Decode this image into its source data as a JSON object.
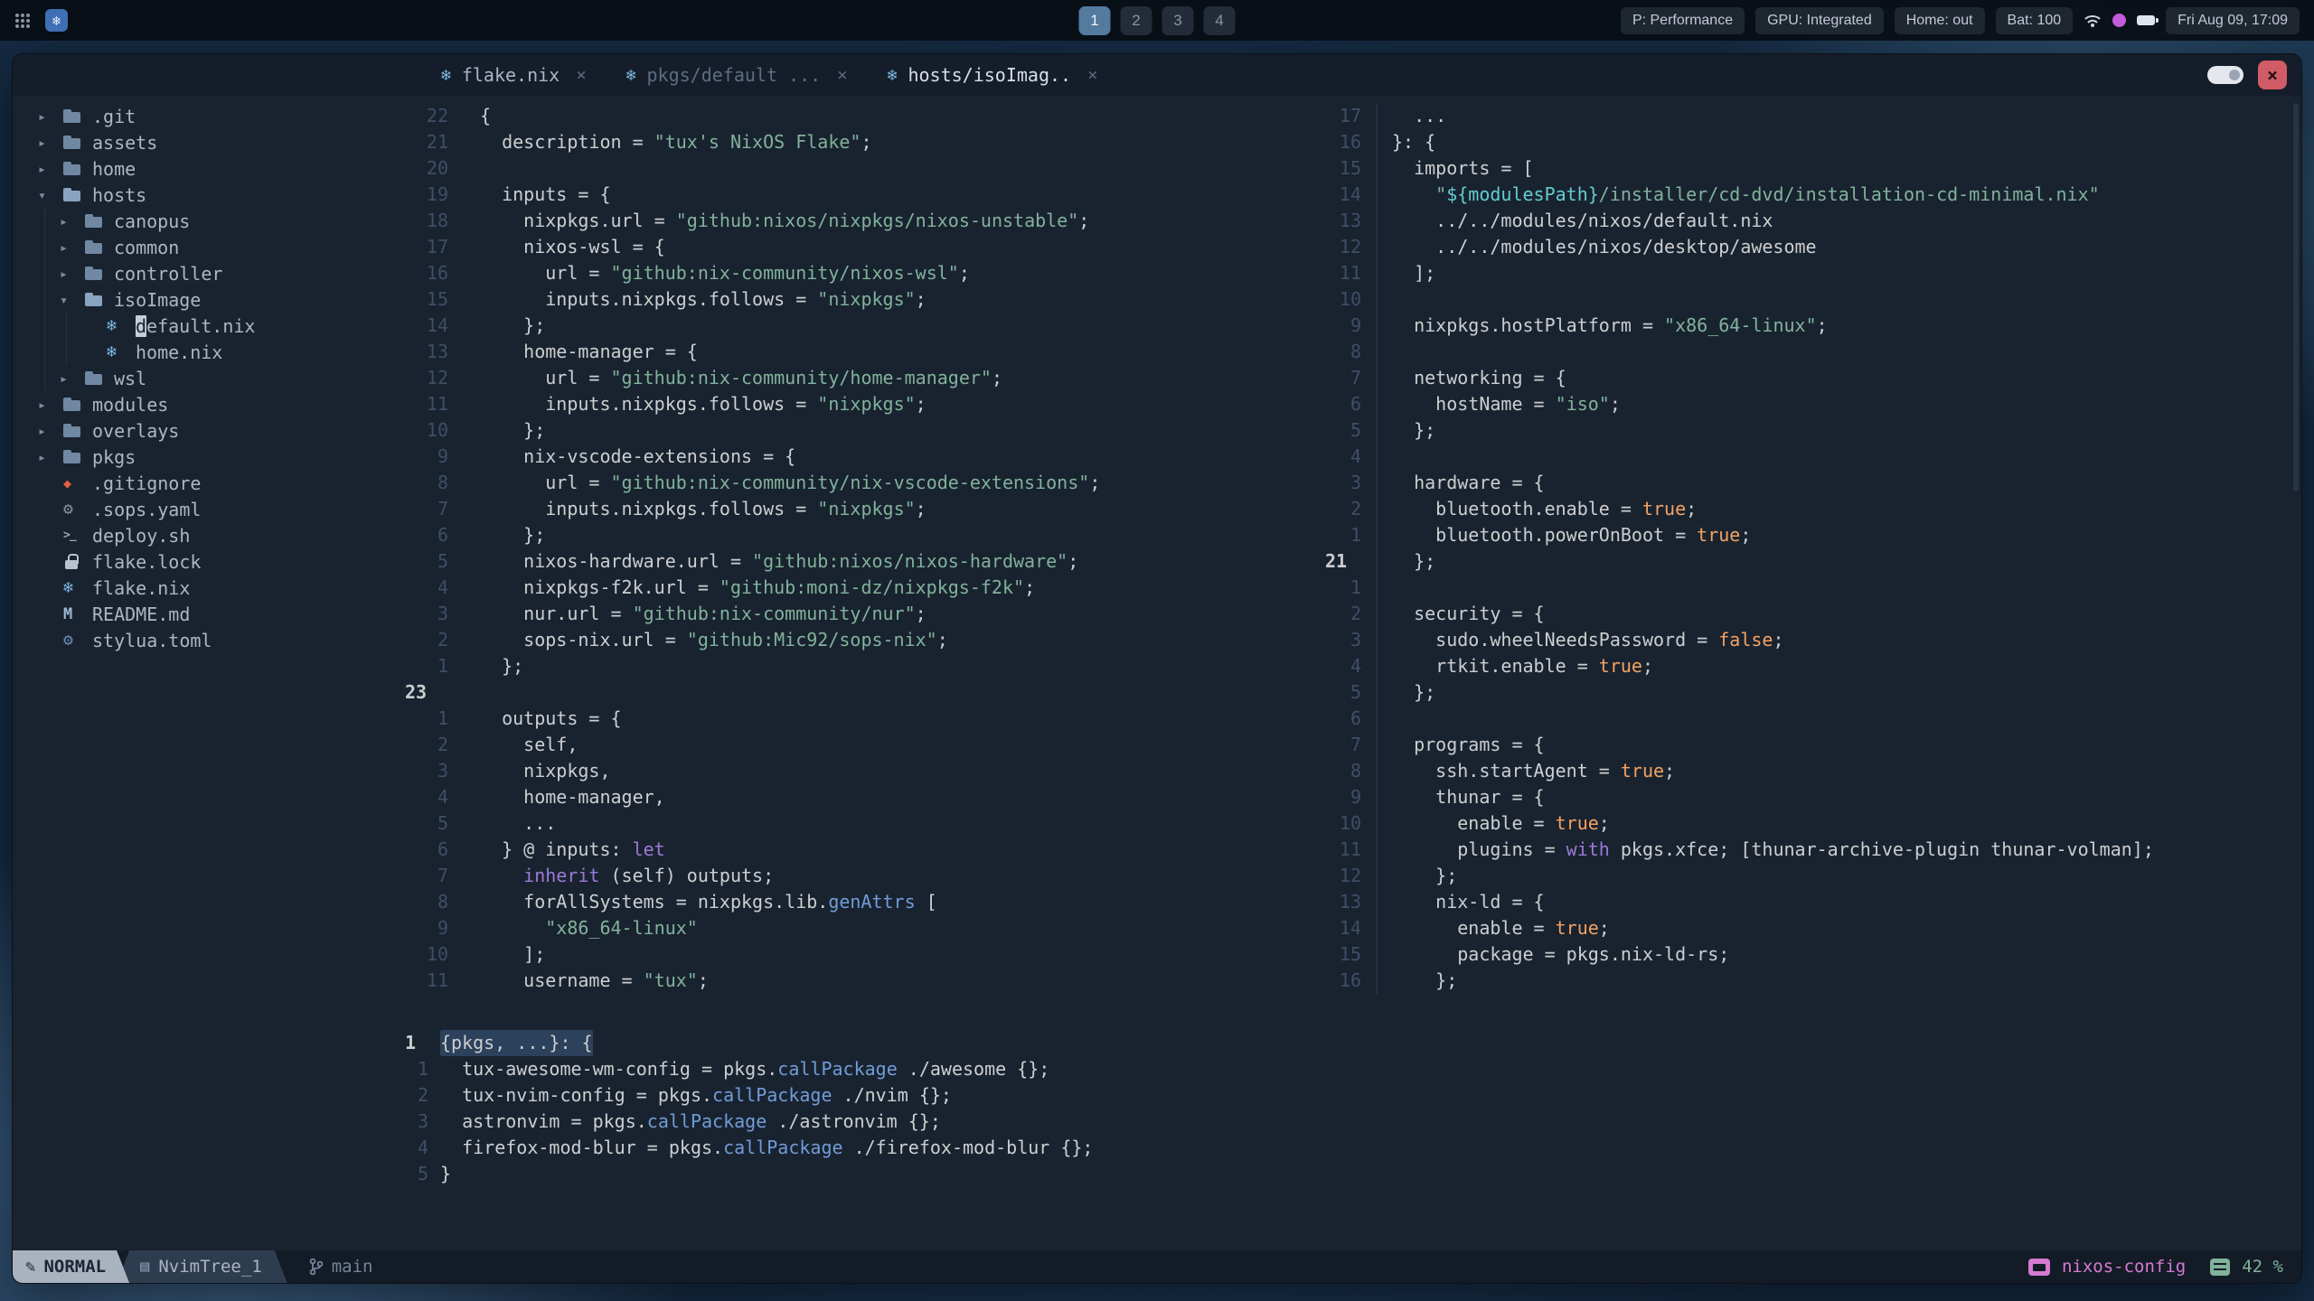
{
  "colors": {
    "editor_bg": "#192330",
    "panel_bg": "#141d29",
    "accent_blue": "#719cd6",
    "nix_blue": "#7ebae4",
    "string_green": "#81b29a",
    "orange": "#f4a261",
    "magenta": "#9d79d6",
    "cyan": "#63cdcf",
    "pink": "#d67ad2",
    "close_red": "#d15b66",
    "foreground": "#cdcecf",
    "workspace_active": "#547a9e"
  },
  "icon_glyphs": {
    "nix": "❄",
    "git": "◆",
    "gear": "⚙",
    "toml": "⚙",
    "shell": ">_",
    "markdown": "M",
    "folder": "",
    "folder-open": "",
    "lock": "",
    "pencil": "✎",
    "buffer": "▤"
  },
  "topbar": {
    "workspaces": [
      "1",
      "2",
      "3",
      "4"
    ],
    "active_workspace": "1",
    "pills": [
      "P: Performance",
      "GPU: Integrated",
      "Home: out",
      "Bat: 100"
    ],
    "clock": "Fri Aug 09, 17:09"
  },
  "window_controls": {
    "close": "×"
  },
  "tabline": {
    "tabs": [
      {
        "icon": "nix",
        "label": "flake.nix",
        "close": "×",
        "state": "inactive-visible"
      },
      {
        "icon": "nix",
        "label": "pkgs/default ...",
        "close": "×",
        "state": "inactive"
      },
      {
        "icon": "nix",
        "label": "hosts/isoImag..",
        "close": "×",
        "state": "active"
      }
    ]
  },
  "tree": {
    "items": [
      {
        "depth": 0,
        "arrow": "▸",
        "icon": "folder",
        "label": ".git"
      },
      {
        "depth": 0,
        "arrow": "▸",
        "icon": "folder",
        "label": "assets"
      },
      {
        "depth": 0,
        "arrow": "▸",
        "icon": "folder",
        "label": "home"
      },
      {
        "depth": 0,
        "arrow": "▾",
        "icon": "folder-open",
        "label": "hosts"
      },
      {
        "depth": 1,
        "arrow": "▸",
        "icon": "folder",
        "label": "canopus"
      },
      {
        "depth": 1,
        "arrow": "▸",
        "icon": "folder",
        "label": "common"
      },
      {
        "depth": 1,
        "arrow": "▸",
        "icon": "folder",
        "label": "controller"
      },
      {
        "depth": 1,
        "arrow": "▾",
        "icon": "folder-open",
        "label": "isoImage"
      },
      {
        "depth": 2,
        "arrow": "",
        "icon": "nix",
        "label": "default.nix",
        "cursor": true
      },
      {
        "depth": 2,
        "arrow": "",
        "icon": "nix",
        "label": "home.nix"
      },
      {
        "depth": 1,
        "arrow": "▸",
        "icon": "folder",
        "label": "wsl"
      },
      {
        "depth": 0,
        "arrow": "▸",
        "icon": "folder",
        "label": "modules"
      },
      {
        "depth": 0,
        "arrow": "▸",
        "icon": "folder",
        "label": "overlays"
      },
      {
        "depth": 0,
        "arrow": "▸",
        "icon": "folder",
        "label": "pkgs"
      },
      {
        "depth": 0,
        "arrow": "",
        "icon": "git",
        "label": ".gitignore"
      },
      {
        "depth": 0,
        "arrow": "",
        "icon": "gear",
        "label": ".sops.yaml"
      },
      {
        "depth": 0,
        "arrow": "",
        "icon": "shell",
        "label": "deploy.sh"
      },
      {
        "depth": 0,
        "arrow": "",
        "icon": "lock",
        "label": "flake.lock"
      },
      {
        "depth": 0,
        "arrow": "",
        "icon": "nix",
        "label": "flake.nix"
      },
      {
        "depth": 0,
        "arrow": "",
        "icon": "markdown",
        "label": "README.md"
      },
      {
        "depth": 0,
        "arrow": "",
        "icon": "toml",
        "label": "stylua.toml"
      }
    ]
  },
  "panes": {
    "left": {
      "file": "flake.nix",
      "lines": [
        {
          "n": "22",
          "t": [
            [
              "f",
              "{"
            ]
          ]
        },
        {
          "n": "21",
          "t": [
            [
              "f",
              "  description = "
            ],
            [
              "s",
              "\"tux's NixOS Flake\""
            ],
            [
              "f",
              ";"
            ]
          ]
        },
        {
          "n": "20",
          "t": []
        },
        {
          "n": "19",
          "t": [
            [
              "f",
              "  inputs = {"
            ]
          ]
        },
        {
          "n": "18",
          "t": [
            [
              "f",
              "    nixpkgs.url = "
            ],
            [
              "s",
              "\"github:nixos/nixpkgs/nixos-unstable\""
            ],
            [
              "f",
              ";"
            ]
          ]
        },
        {
          "n": "17",
          "t": [
            [
              "f",
              "    nixos-wsl = {"
            ]
          ]
        },
        {
          "n": "16",
          "t": [
            [
              "f",
              "      url = "
            ],
            [
              "s",
              "\"github:nix-community/nixos-wsl\""
            ],
            [
              "f",
              ";"
            ]
          ]
        },
        {
          "n": "15",
          "t": [
            [
              "f",
              "      inputs.nixpkgs.follows = "
            ],
            [
              "s",
              "\"nixpkgs\""
            ],
            [
              "f",
              ";"
            ]
          ]
        },
        {
          "n": "14",
          "t": [
            [
              "f",
              "    };"
            ]
          ]
        },
        {
          "n": "13",
          "t": [
            [
              "f",
              "    home-manager = {"
            ]
          ]
        },
        {
          "n": "12",
          "t": [
            [
              "f",
              "      url = "
            ],
            [
              "s",
              "\"github:nix-community/home-manager\""
            ],
            [
              "f",
              ";"
            ]
          ]
        },
        {
          "n": "11",
          "t": [
            [
              "f",
              "      inputs.nixpkgs.follows = "
            ],
            [
              "s",
              "\"nixpkgs\""
            ],
            [
              "f",
              ";"
            ]
          ]
        },
        {
          "n": "10",
          "t": [
            [
              "f",
              "    };"
            ]
          ]
        },
        {
          "n": "9",
          "t": [
            [
              "f",
              "    nix-vscode-extensions = {"
            ]
          ]
        },
        {
          "n": "8",
          "t": [
            [
              "f",
              "      url = "
            ],
            [
              "s",
              "\"github:nix-community/nix-vscode-extensions\""
            ],
            [
              "f",
              ";"
            ]
          ]
        },
        {
          "n": "7",
          "t": [
            [
              "f",
              "      inputs.nixpkgs.follows = "
            ],
            [
              "s",
              "\"nixpkgs\""
            ],
            [
              "f",
              ";"
            ]
          ]
        },
        {
          "n": "6",
          "t": [
            [
              "f",
              "    };"
            ]
          ]
        },
        {
          "n": "5",
          "t": [
            [
              "f",
              "    nixos-hardware.url = "
            ],
            [
              "s",
              "\"github:nixos/nixos-hardware\""
            ],
            [
              "f",
              ";"
            ]
          ]
        },
        {
          "n": "4",
          "t": [
            [
              "f",
              "    nixpkgs-f2k.url = "
            ],
            [
              "s",
              "\"github:moni-dz/nixpkgs-f2k\""
            ],
            [
              "f",
              ";"
            ]
          ]
        },
        {
          "n": "3",
          "t": [
            [
              "f",
              "    nur.url = "
            ],
            [
              "s",
              "\"github:nix-community/nur\""
            ],
            [
              "f",
              ";"
            ]
          ]
        },
        {
          "n": "2",
          "t": [
            [
              "f",
              "    sops-nix.url = "
            ],
            [
              "s",
              "\"github:Mic92/sops-nix\""
            ],
            [
              "f",
              ";"
            ]
          ]
        },
        {
          "n": "1",
          "t": [
            [
              "f",
              "  };"
            ]
          ]
        },
        {
          "n": "23",
          "cur": true,
          "t": []
        },
        {
          "n": "1",
          "t": [
            [
              "f",
              "  outputs = {"
            ]
          ]
        },
        {
          "n": "2",
          "t": [
            [
              "f",
              "    self,"
            ]
          ]
        },
        {
          "n": "3",
          "t": [
            [
              "f",
              "    nixpkgs,"
            ]
          ]
        },
        {
          "n": "4",
          "t": [
            [
              "f",
              "    home-manager,"
            ]
          ]
        },
        {
          "n": "5",
          "t": [
            [
              "f",
              "    ..."
            ]
          ]
        },
        {
          "n": "6",
          "t": [
            [
              "f",
              "  } @ inputs: "
            ],
            [
              "k",
              "let"
            ]
          ]
        },
        {
          "n": "7",
          "t": [
            [
              "f",
              "    "
            ],
            [
              "k",
              "inherit"
            ],
            [
              "f",
              " (self) outputs;"
            ]
          ]
        },
        {
          "n": "8",
          "t": [
            [
              "f",
              "    forAllSystems = nixpkgs.lib."
            ],
            [
              "u",
              "genAttrs"
            ],
            [
              "f",
              " ["
            ]
          ]
        },
        {
          "n": "9",
          "t": [
            [
              "f",
              "      "
            ],
            [
              "s",
              "\"x86_64-linux\""
            ]
          ]
        },
        {
          "n": "10",
          "t": [
            [
              "f",
              "    ];"
            ]
          ]
        },
        {
          "n": "11",
          "t": [
            [
              "f",
              "    username = "
            ],
            [
              "s",
              "\"tux\""
            ],
            [
              "f",
              ";"
            ]
          ]
        }
      ]
    },
    "right": {
      "file": "hosts/isoImage/default.nix",
      "lines": [
        {
          "n": "17",
          "t": [
            [
              "f",
              "  ..."
            ]
          ]
        },
        {
          "n": "16",
          "t": [
            [
              "f",
              "}: {"
            ]
          ]
        },
        {
          "n": "15",
          "t": [
            [
              "f",
              "  imports = ["
            ]
          ]
        },
        {
          "n": "14",
          "t": [
            [
              "f",
              "    "
            ],
            [
              "s",
              "\""
            ],
            [
              "c",
              "${modulesPath}"
            ],
            [
              "s",
              "/installer/cd-dvd/installation-cd-minimal.nix\""
            ]
          ]
        },
        {
          "n": "13",
          "t": [
            [
              "f",
              "    ../../modules/nixos/default.nix"
            ]
          ]
        },
        {
          "n": "12",
          "t": [
            [
              "f",
              "    ../../modules/nixos/desktop/awesome"
            ]
          ]
        },
        {
          "n": "11",
          "t": [
            [
              "f",
              "  ];"
            ]
          ]
        },
        {
          "n": "10",
          "t": []
        },
        {
          "n": "9",
          "t": [
            [
              "f",
              "  nixpkgs.hostPlatform = "
            ],
            [
              "s",
              "\"x86_64-linux\""
            ],
            [
              "f",
              ";"
            ]
          ]
        },
        {
          "n": "8",
          "t": []
        },
        {
          "n": "7",
          "t": [
            [
              "f",
              "  networking = {"
            ]
          ]
        },
        {
          "n": "6",
          "t": [
            [
              "f",
              "    hostName = "
            ],
            [
              "s",
              "\"iso\""
            ],
            [
              "f",
              ";"
            ]
          ]
        },
        {
          "n": "5",
          "t": [
            [
              "f",
              "  };"
            ]
          ]
        },
        {
          "n": "4",
          "t": []
        },
        {
          "n": "3",
          "t": [
            [
              "f",
              "  hardware = {"
            ]
          ]
        },
        {
          "n": "2",
          "t": [
            [
              "f",
              "    bluetooth.enable = "
            ],
            [
              "b",
              "true"
            ],
            [
              "f",
              ";"
            ]
          ]
        },
        {
          "n": "1",
          "t": [
            [
              "f",
              "    bluetooth.powerOnBoot = "
            ],
            [
              "b",
              "true"
            ],
            [
              "f",
              ";"
            ]
          ]
        },
        {
          "n": "21",
          "cur": true,
          "t": [
            [
              "f",
              "  };"
            ]
          ]
        },
        {
          "n": "1",
          "t": []
        },
        {
          "n": "2",
          "t": [
            [
              "f",
              "  security = {"
            ]
          ]
        },
        {
          "n": "3",
          "t": [
            [
              "f",
              "    sudo.wheelNeedsPassword = "
            ],
            [
              "b",
              "false"
            ],
            [
              "f",
              ";"
            ]
          ]
        },
        {
          "n": "4",
          "t": [
            [
              "f",
              "    rtkit.enable = "
            ],
            [
              "b",
              "true"
            ],
            [
              "f",
              ";"
            ]
          ]
        },
        {
          "n": "5",
          "t": [
            [
              "f",
              "  };"
            ]
          ]
        },
        {
          "n": "6",
          "t": []
        },
        {
          "n": "7",
          "t": [
            [
              "f",
              "  programs = {"
            ]
          ]
        },
        {
          "n": "8",
          "t": [
            [
              "f",
              "    ssh.startAgent = "
            ],
            [
              "b",
              "true"
            ],
            [
              "f",
              ";"
            ]
          ]
        },
        {
          "n": "9",
          "t": [
            [
              "f",
              "    thunar = {"
            ]
          ]
        },
        {
          "n": "10",
          "t": [
            [
              "f",
              "      enable = "
            ],
            [
              "b",
              "true"
            ],
            [
              "f",
              ";"
            ]
          ]
        },
        {
          "n": "11",
          "t": [
            [
              "f",
              "      plugins = "
            ],
            [
              "k",
              "with"
            ],
            [
              "f",
              " pkgs.xfce; [thunar-archive-plugin thunar-volman];"
            ]
          ]
        },
        {
          "n": "12",
          "t": [
            [
              "f",
              "    };"
            ]
          ]
        },
        {
          "n": "13",
          "t": [
            [
              "f",
              "    nix-ld = {"
            ]
          ]
        },
        {
          "n": "14",
          "t": [
            [
              "f",
              "      enable = "
            ],
            [
              "b",
              "true"
            ],
            [
              "f",
              ";"
            ]
          ]
        },
        {
          "n": "15",
          "t": [
            [
              "f",
              "      package = pkgs.nix-ld-rs;"
            ]
          ]
        },
        {
          "n": "16",
          "t": [
            [
              "f",
              "    };"
            ]
          ]
        }
      ]
    },
    "bottom": {
      "file": "pkgs/default.nix",
      "lines": [
        {
          "n": "1",
          "cur": true,
          "sel": true,
          "t": [
            [
              "f",
              "{pkgs, ...}: {"
            ]
          ]
        },
        {
          "n": "1",
          "t": [
            [
              "f",
              "  tux-awesome-wm-config = pkgs."
            ],
            [
              "u",
              "callPackage"
            ],
            [
              "f",
              " ./awesome {};"
            ]
          ]
        },
        {
          "n": "2",
          "t": [
            [
              "f",
              "  tux-nvim-config = pkgs."
            ],
            [
              "u",
              "callPackage"
            ],
            [
              "f",
              " ./nvim {};"
            ]
          ]
        },
        {
          "n": "3",
          "t": [
            [
              "f",
              "  astronvim = pkgs."
            ],
            [
              "u",
              "callPackage"
            ],
            [
              "f",
              " ./astronvim {};"
            ]
          ]
        },
        {
          "n": "4",
          "t": [
            [
              "f",
              "  firefox-mod-blur = pkgs."
            ],
            [
              "u",
              "callPackage"
            ],
            [
              "f",
              " ./firefox-mod-blur {};"
            ]
          ]
        },
        {
          "n": "5",
          "t": [
            [
              "f",
              "}"
            ]
          ]
        }
      ]
    }
  },
  "statusline": {
    "mode": "NORMAL",
    "buffer": "NvimTree_1",
    "branch": "main",
    "project": "nixos-config",
    "progress": "42 %"
  }
}
